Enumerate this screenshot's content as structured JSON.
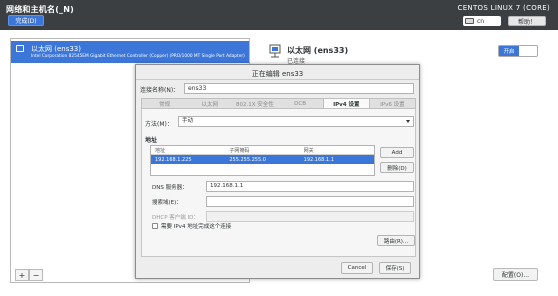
{
  "topbar": {
    "title": "网络和主机名(_N)",
    "done_label": "完成(D)",
    "product": "CENTOS LINUX 7 (CORE)",
    "keyboard_layout": "cn",
    "help_label": "帮助！"
  },
  "device_list": {
    "items": [
      {
        "name": "以太网 (ens33)",
        "description": "Intel Corporation 82545EM Gigabit Ethernet Controller (Copper) (PRO/1000 MT Single Port Adapter)"
      }
    ],
    "add_label": "+",
    "remove_label": "−"
  },
  "device_detail": {
    "name": "以太网 (ens33)",
    "status": "已连接",
    "toggle_label": "开启",
    "configure_label": "配置(O)..."
  },
  "dialog": {
    "title": "正在编辑 ens33",
    "connection_name_label": "连接名称(N)：",
    "connection_name_value": "ens33",
    "tabs": [
      "常规",
      "以太网",
      "802.1X 安全性",
      "DCB",
      "IPv4 设置",
      "IPv6 设置"
    ],
    "active_tab": "IPv4 设置",
    "method_label": "方法(M)：",
    "method_value": "手动",
    "addresses_heading": "地址",
    "address_columns": [
      "地址",
      "子网掩码",
      "网关"
    ],
    "address_rows": [
      [
        "192.168.1.225",
        "255.255.255.0",
        "192.168.1.1"
      ]
    ],
    "add_label": "Add",
    "delete_label": "删除(D)",
    "dns_label": "DNS 服务器：",
    "dns_value": "192.168.1.1",
    "search_domain_label": "搜索域(E)：",
    "search_domain_value": "",
    "dhcp_client_id_label": "DHCP 客户端 ID：",
    "dhcp_client_id_value": "",
    "require_ipv4_label": "需要 IPv4 地址完成这个连接",
    "routes_label": "路由(R)...",
    "cancel_label": "Cancel",
    "save_label": "保存(S)"
  },
  "colors": {
    "topbar_bg": "#3b3f42",
    "accent_blue": "#3b76d8",
    "dialog_bg": "#ededed"
  }
}
